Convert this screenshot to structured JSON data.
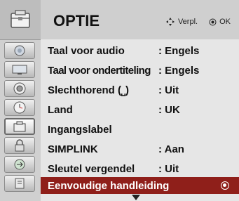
{
  "header": {
    "title": "OPTIE",
    "move_hint": "Verpl.",
    "ok_hint": "OK"
  },
  "sidebar": {
    "items": [
      {
        "icon": "picture-icon"
      },
      {
        "icon": "screen-icon"
      },
      {
        "icon": "audio-icon"
      },
      {
        "icon": "clock-icon"
      },
      {
        "icon": "option-icon",
        "active": true
      },
      {
        "icon": "lock-icon"
      },
      {
        "icon": "input-icon"
      },
      {
        "icon": "usb-icon"
      }
    ]
  },
  "menu": {
    "rows": [
      {
        "label": "Taal voor audio",
        "value": ": Engels"
      },
      {
        "label": "Taal voor ondertiteling",
        "value": ": Engels"
      },
      {
        "label": "Slechthorend (⎵)",
        "value": ": Uit"
      },
      {
        "label": "Land",
        "value": ": UK"
      },
      {
        "label": "Ingangslabel",
        "value": ""
      },
      {
        "label": "SIMPLINK",
        "value": ": Aan"
      },
      {
        "label": "Sleutel vergendel",
        "value": ": Uit"
      },
      {
        "label": "Eenvoudige handleiding",
        "value": "",
        "selected": true
      }
    ]
  },
  "colors": {
    "selected_bg": "#8f1f1a"
  }
}
